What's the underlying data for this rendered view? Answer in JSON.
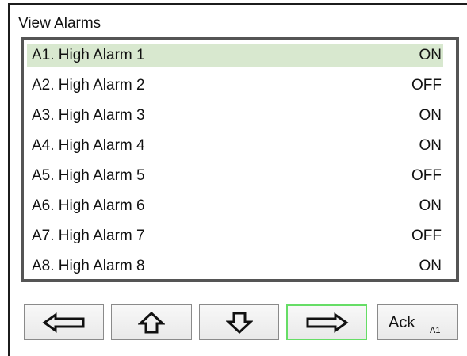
{
  "header": {
    "title": "View Alarms"
  },
  "alarms": [
    {
      "label": "A1. High Alarm 1",
      "state": "ON"
    },
    {
      "label": "A2. High Alarm 2",
      "state": "OFF"
    },
    {
      "label": "A3. High Alarm 3",
      "state": "ON"
    },
    {
      "label": "A4. High Alarm 4",
      "state": "ON"
    },
    {
      "label": "A5. High Alarm 5",
      "state": "OFF"
    },
    {
      "label": "A6. High Alarm 6",
      "state": "ON"
    },
    {
      "label": "A7. High Alarm 7",
      "state": "OFF"
    },
    {
      "label": "A8. High Alarm 8",
      "state": "ON"
    }
  ],
  "selected_index": 0,
  "toolbar": {
    "buttons": [
      {
        "icon": "arrow-left-icon"
      },
      {
        "icon": "arrow-up-icon"
      },
      {
        "icon": "arrow-down-icon"
      },
      {
        "icon": "arrow-right-icon",
        "active": true
      }
    ],
    "ack_label": "Ack",
    "ack_sub": "A1"
  },
  "colors": {
    "selected_row": "#d8e8cf",
    "list_border": "#555555",
    "active_button_border": "#66dd66"
  }
}
